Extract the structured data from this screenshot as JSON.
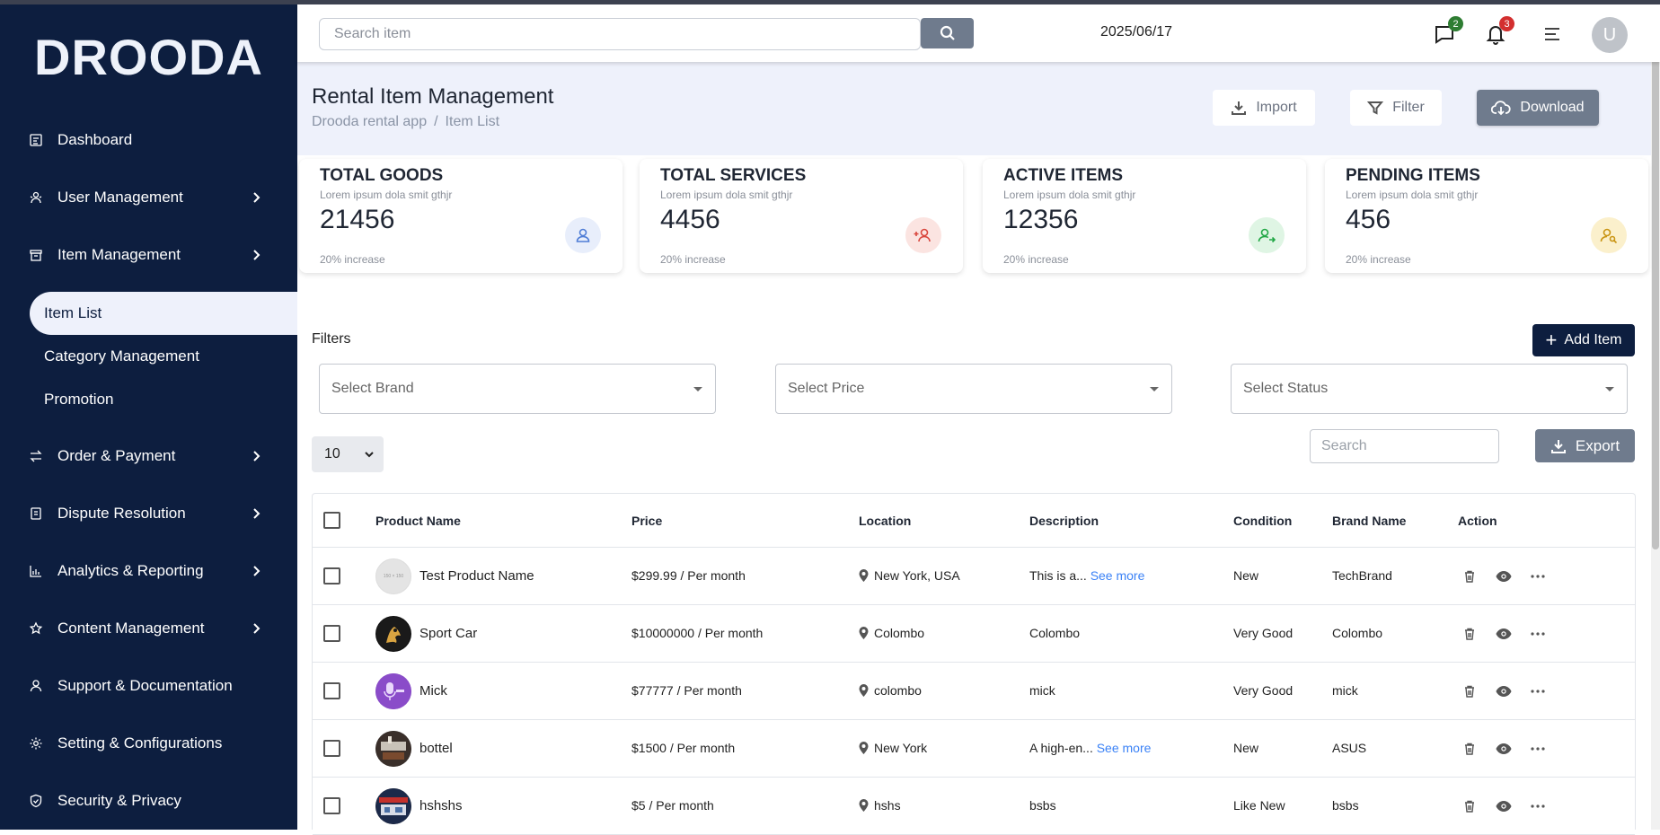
{
  "app": {
    "logo": "DROODA"
  },
  "sidebar": {
    "items": [
      {
        "label": "Dashboard",
        "icon": "dashboard-icon"
      },
      {
        "label": "User Management",
        "icon": "users-icon",
        "has_children": true
      },
      {
        "label": "Item Management",
        "icon": "box-icon",
        "has_children": true,
        "expanded": true
      },
      {
        "label": "Order & Payment",
        "icon": "exchange-icon",
        "has_children": true
      },
      {
        "label": "Dispute Resolution",
        "icon": "document-icon",
        "has_children": true
      },
      {
        "label": "Analytics & Reporting",
        "icon": "bar-chart-icon",
        "has_children": true
      },
      {
        "label": "Content Management",
        "icon": "star-icon",
        "has_children": true
      },
      {
        "label": "Support & Documentation",
        "icon": "user-icon"
      },
      {
        "label": "Setting & Configurations",
        "icon": "gear-icon"
      },
      {
        "label": "Security & Privacy",
        "icon": "shield-icon"
      }
    ],
    "subitems": [
      {
        "label": "Item List",
        "active": true
      },
      {
        "label": "Category Management",
        "active": false
      },
      {
        "label": "Promotion",
        "active": false
      }
    ]
  },
  "header": {
    "search_placeholder": "Search item",
    "date": "2025/06/17",
    "messages_count": "2",
    "notifications_count": "3",
    "avatar_initial": "U"
  },
  "page": {
    "title": "Rental Item Management",
    "breadcrumb": [
      "Drooda rental app",
      "/",
      "Item List"
    ],
    "import_label": "Import",
    "filter_label": "Filter",
    "download_label": "Download"
  },
  "stats": [
    {
      "title": "TOTAL GOODS",
      "subtitle": "Lorem ipsum dola smit gthjr",
      "value": "21456",
      "footer": "20% increase",
      "icon": "user-icon",
      "color": "#4f7dd6",
      "bg": "#e8eefb"
    },
    {
      "title": "TOTAL SERVICES",
      "subtitle": "Lorem ipsum dola smit gthjr",
      "value": "4456",
      "footer": "20% increase",
      "icon": "user-plus-icon",
      "color": "#d9463d",
      "bg": "#fbe4e1"
    },
    {
      "title": "ACTIVE ITEMS",
      "subtitle": "Lorem ipsum dola smit gthjr",
      "value": "12356",
      "footer": "20% increase",
      "icon": "user-check-icon",
      "color": "#22a846",
      "bg": "#dff5e4"
    },
    {
      "title": "PENDING ITEMS",
      "subtitle": "Lorem ipsum dola smit gthjr",
      "value": "456",
      "footer": "20% increase",
      "icon": "user-search-icon",
      "color": "#c99412",
      "bg": "#fbf0cc"
    }
  ],
  "filters": {
    "label": "Filters",
    "add_item_label": "Add Item",
    "brand_placeholder": "Select Brand",
    "price_placeholder": "Select Price",
    "status_placeholder": "Select Status",
    "per_page": "10",
    "search_placeholder": "Search",
    "export_label": "Export"
  },
  "table": {
    "columns": [
      "Product Name",
      "Price",
      "Location",
      "Description",
      "Condition",
      "Brand Name",
      "Action"
    ],
    "rows": [
      {
        "name": "Test Product Name",
        "price": "$299.99 / Per month",
        "location": "New York, USA",
        "description": "This is a...",
        "see_more": "See more",
        "condition": "New",
        "brand": "TechBrand",
        "thumb_text": "150 × 150"
      },
      {
        "name": "Sport Car",
        "price": "$10000000 / Per month",
        "location": "Colombo",
        "description": "Colombo",
        "see_more": "",
        "condition": "Very Good",
        "brand": "Colombo",
        "thumb_text": ""
      },
      {
        "name": "Mick",
        "price": "$77777 / Per month",
        "location": "colombo",
        "description": "mick",
        "see_more": "",
        "condition": "Very Good",
        "brand": "mick",
        "thumb_text": ""
      },
      {
        "name": "bottel",
        "price": "$1500 / Per month",
        "location": "New York",
        "description": "A high-en...",
        "see_more": "See more",
        "condition": "New",
        "brand": "ASUS",
        "thumb_text": ""
      },
      {
        "name": "hshshs",
        "price": "$5 / Per month",
        "location": "hshs",
        "description": "bsbs",
        "see_more": "",
        "condition": "Like New",
        "brand": "bsbs",
        "thumb_text": ""
      }
    ]
  }
}
